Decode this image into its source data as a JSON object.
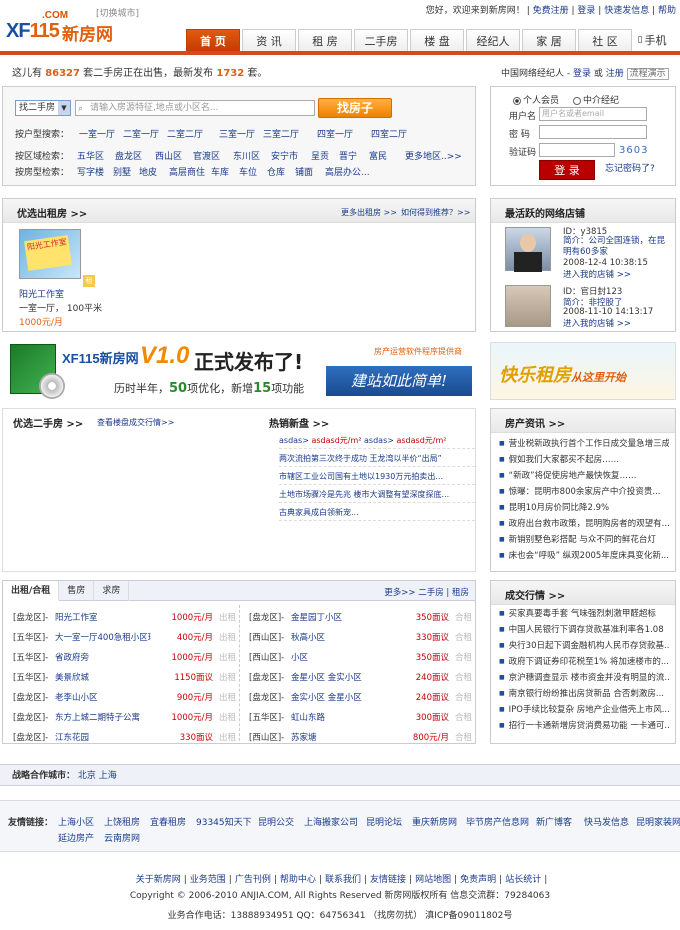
{
  "header": {
    "logo_com": ".COM",
    "logo_xf": "XF",
    "logo_num": "115",
    "logo_cn": "新房网",
    "switch_city": "[切换城市]",
    "top_links": [
      "您好，欢迎来到新房网！",
      "免费注册",
      "登录",
      "快速发信息",
      "帮助"
    ]
  },
  "nav": {
    "items": [
      "首 页",
      "资 讯",
      "租 房",
      "二手房",
      "楼 盘",
      "经纪人",
      "家 居",
      "社 区"
    ],
    "mobile": "手机"
  },
  "stats": {
    "prefix": "这儿有",
    "count": "86327",
    "middle": "套二手房正在出售，最新发布",
    "latest": "1732",
    "suffix": "套。"
  },
  "agent_bar": {
    "label": "中国网络经纪人 -",
    "login": "登录",
    "or": "或",
    "register": "注册",
    "demo": "流程演示"
  },
  "search": {
    "type": "找二手房",
    "placeholder": "请输入房源特征,地点或小区名...",
    "button": "找房子",
    "layout_label": "按户型搜索：",
    "layouts": [
      "一室一厅",
      "二室一厅",
      "二室二厅",
      "三室一厅",
      "三室二厅",
      "四室一厅",
      "四室二厅"
    ],
    "district_label": "按区域检索：",
    "districts": [
      "五华区",
      "盘龙区",
      "西山区",
      "官渡区",
      "东川区",
      "安宁市",
      "呈贡",
      "晋宁",
      "富民",
      "更多地区..>>"
    ],
    "type_label": "按房型检索：",
    "types": [
      "写字楼",
      "别墅",
      "地皮",
      "高层商住",
      "车库",
      "车位",
      "仓库",
      "铺面",
      "高层办公..."
    ]
  },
  "login": {
    "personal": "个人会员",
    "agent": "中介经纪",
    "user_label": "用户名",
    "user_placeholder": "用户名或者email",
    "pass_label": "密 码",
    "code_label": "验证码",
    "captcha": "3603",
    "button": "登 录",
    "forgot": "忘记密码了?"
  },
  "rental": {
    "title": "优选出租房 >>",
    "more": "更多出租房 >>",
    "how": "如何得到推荐？>>",
    "thumb_text": "阳光工作室",
    "tag": "租",
    "name": "阳光工作室",
    "info": "一室一厅，  100平米",
    "price": "1000元/月"
  },
  "stores": {
    "title": "最活跃的网络店铺",
    "items": [
      {
        "id": "ID：y3815",
        "intro": "简介：公司全国连锁，在昆明有60多家",
        "time": "2008-12-4 10:38:15",
        "link": "进入我的店铺 >>"
      },
      {
        "id": "ID：官日封123",
        "intro": "简介：非控股了",
        "time": "2008-11-10 14:13:17",
        "link": "进入我的店铺 >>"
      }
    ]
  },
  "banner": {
    "logo": "XF115新房网",
    "version": "V1.0",
    "title": "正式发布了!",
    "sub_a": "历时半年，",
    "sub_n1": "50",
    "sub_b": "项优化，新增",
    "sub_n2": "15",
    "sub_c": "项功能",
    "provider": "房产运营软件程序提供商",
    "build": "建站如此简单!",
    "right_text": "快乐租房",
    "right_sub": "从这里开始"
  },
  "secondhand": {
    "title": "优选二手房 >>",
    "view": "查看楼盘成交行情>>",
    "new_title": "热销新盘 >>",
    "new_items": [
      [
        "asdas>",
        "asdasd元/m²",
        "asdas>",
        "asdasd元/m²"
      ],
      [
        "两次流拍第三次终于成功 王龙湾以半价“出局”"
      ],
      [
        "市辖区工业公司国有土地以1930万元拍卖出..."
      ],
      [
        "土地市场骤冷是先兆 楼市大调整有望深度探底..."
      ],
      [
        "古典家具成白领新宠..."
      ]
    ]
  },
  "news": {
    "title": "房产资讯 >>",
    "items": [
      "营业税新政执行首个工作日成交量急增三成",
      "假如我们大家都买不起房……",
      "“新政”将促使房地产最快恢复……",
      "惊曝：昆明市800余家房产中介投资贵...",
      "昆明10月房价同比降2.9%",
      "政府出台救市政策，昆明购房者的观望有...",
      "新销别墅色彩搭配  与众不同的鲜花台灯",
      "床也会“呼吸” 纵观2005年度床具变化新..."
    ]
  },
  "table": {
    "tabs": [
      "出租/合租",
      "售房",
      "求房"
    ],
    "more": "更多>> 二手房 | 租房",
    "left": [
      [
        "[盘龙区]-",
        "阳光工作室",
        "1000元/月",
        "出租"
      ],
      [
        "[五华区]-",
        "大一室一厅400急租小区环...",
        "400元/月",
        "出租"
      ],
      [
        "[五华区]-",
        "省政府旁",
        "1000元/月",
        "出租"
      ],
      [
        "[五华区]-",
        "美景欣城",
        "1150面议",
        "出租"
      ],
      [
        "[盘龙区]-",
        "老李山小区",
        "900元/月",
        "出租"
      ],
      [
        "[盘龙区]-",
        "东方上城二期特子公寓",
        "1000元/月",
        "出租"
      ],
      [
        "[盘龙区]-",
        "江东花园",
        "330面议",
        "出租"
      ]
    ],
    "right": [
      [
        "[盘龙区]-",
        "金星园丁小区",
        "350面议",
        "合租"
      ],
      [
        "[西山区]-",
        "秋高小区",
        "330面议",
        "合租"
      ],
      [
        "[西山区]-",
        "小区",
        "350面议",
        "合租"
      ],
      [
        "[盘龙区]-",
        "金星小区 金实小区",
        "240面议",
        "合租"
      ],
      [
        "[盘龙区]-",
        "金实小区 金星小区",
        "240面议",
        "合租"
      ],
      [
        "[五华区]-",
        "虹山东路",
        "300面议",
        "合租"
      ],
      [
        "[西山区]-",
        "苏家塘",
        "800元/月",
        "合租"
      ]
    ]
  },
  "deals": {
    "title": "成交行情 >>",
    "items": [
      "买家真要毒手套 气味强烈刺激甲醛超标",
      "中国人民银行下调存贷款基准利率各1.08",
      "央行30日起下调金融机构人民币存贷款基...",
      "政府下调证券印花税至1% 将加速楼市的...",
      "京沪穗调查显示 楼市资金并没有明显的流...",
      "南京银行纷纷推出房贷新品 合否刺激房...",
      "IPO手续比较复杂 房地产企业借壳上市风...",
      "招行一卡通新增房贷消费易功能 一卡通可..."
    ]
  },
  "footer": {
    "strategic_label": "战略合作城市：",
    "cities": [
      "北京",
      "上海"
    ],
    "friends_label": "友情链接：",
    "friends": [
      "上海小区",
      "上饶租房",
      "宜春租房",
      "93345知天下",
      "昆明公交",
      "上海搬家公司",
      "昆明论坛",
      "重庆新房网",
      "毕节房产信息网",
      "新广博客",
      "快马发信息",
      "昆明家装网",
      "延边房产",
      "云南房网"
    ],
    "links": [
      "关于新房网",
      "业务范围",
      "广告刊例",
      "帮助中心",
      "联系我们",
      "友情链接",
      "网站地图",
      "免责声明",
      "站长统计"
    ],
    "copyright": "Copyright © 2006-2010 ANJIA.COM, All Rights Reserved 新房网版权所有  信息交流群：79284063",
    "contact": "业务合作电话：13888934951 QQ：64756341 （找房勿扰）      滇ICP备09011802号"
  }
}
